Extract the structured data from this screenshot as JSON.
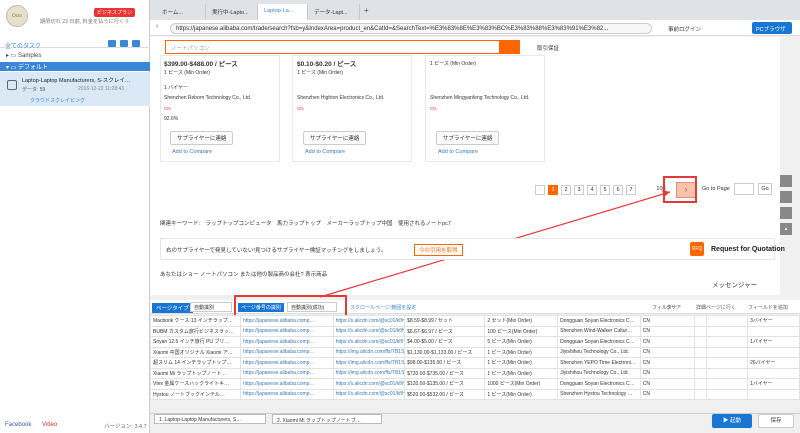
{
  "sidebar": {
    "premium": "ビジネスプラン",
    "trial": "期限切れ 22 日前, 料金を払うに行く 》",
    "tasks_title": "全てのタスク",
    "samples": "Samples",
    "default": "デフォルト",
    "task_title": "Laptop-Laptop Manufacturers, S-スクレイ…",
    "task_data": "データ: 59",
    "task_date": "2016-12-22 11:28:43",
    "task_cloud": "クラウドスクレイピング",
    "facebook": "Facebook",
    "video": "Video",
    "version": "バージョン: 3.4.7"
  },
  "tabs": [
    "ホーム...",
    "実行中-Lapto...",
    "Laptop-La...",
    "データ-Lapt..."
  ],
  "address": {
    "url": "https://japanese.alibaba.com/trade/search?fsb=y&IndexArea=product_en&CatId=&SearchText=%E3%83%8E%E3%83%BC%E3%83%88%E3%83%91%E3%82...",
    "login": "事前ログイン",
    "pc_label": "PCブラウザ"
  },
  "page": {
    "search_placeholder": "ノートパソコン",
    "verify": "取引保証",
    "cards": [
      {
        "price": "$399.00-$488.00 / ピース",
        "moq": "1 ピース (Min Order)",
        "buyer": "1 バイヤー",
        "company": "Shenzhen Reborn Technology Co., Ltd.",
        "country": "CN",
        "rate": "92.6%",
        "contact": "サプライヤーに連絡",
        "compare": "Add to Compare"
      },
      {
        "price": "$0.10-$0.20 / ピース",
        "moq": "1 ピース (Min Order)",
        "buyer": "",
        "company": "Shenzhen Highton Electronics Co., Ltd.",
        "country": "CN",
        "rate": "",
        "contact": "サプライヤーに連絡",
        "compare": "Add to Compare"
      },
      {
        "price": "",
        "moq": "1 ピース (Min Order)",
        "buyer": "",
        "company": "Shenzhen Mingyanfeng Technology Co., Ltd.",
        "country": "CN",
        "rate": "",
        "contact": "サプライヤーに連絡",
        "compare": "Add to Compare"
      }
    ],
    "pages": [
      "1",
      "2",
      "3",
      "4",
      "5",
      "6",
      "7",
      "100"
    ],
    "goto": "Go to Page",
    "go": "Go",
    "related": "関連キーワード:　ラップトップコンピュータ　馬力ラップトップ　メーカーラップトップ中国　使用されるノートpc7",
    "supplier_msg": "右のサプライヤーで発見していない!見つけるサプライヤー検証マッチングをしましょう。",
    "supplier_btn": "今の引用を取得",
    "rfq_icon": "RFQ",
    "rfq": "Request for Quotation",
    "supplier_q": "あなたはショー ノートパソコン または他の製品商の会社? 表示商品",
    "message": "メッセンジャー"
  },
  "data_toolbar": {
    "page_type": "ページタイプ",
    "auto_id": "自動識別",
    "page_num": "ページ番号の識別",
    "page_num_val": "自動識別(成功)",
    "scroll": "スクロールページ 範囲を設定",
    "filter": "フィルター",
    "clear": "クリア",
    "view": "詳細ページに行く",
    "add_field": "フィールドを追加"
  },
  "rows": [
    [
      "Macbook ケース 13 インチラップ…",
      "https://japanese.alibaba.comp…",
      "https://s.alicdn.com/@sc01/kf/H…",
      "$8.59-$8.99 / セット",
      "2 セット(Min Order)",
      "Dongguan Soyan Electronics C…",
      "CN",
      "",
      "",
      "3バイヤー"
    ],
    [
      "BUBM カスタム旅行ビジネスラッ…",
      "https://japanese.alibaba.comp…",
      "https://s.alicdn.com/@sc01/kf/H…",
      "$6.67-$6.97 / ピース",
      "100 ピース(Min Order)",
      "Shenzhen Wind-Walker Cultur…",
      "CN",
      "",
      "",
      ""
    ],
    [
      "Soyan 12.5 インチ旅行 PU ブリ…",
      "https://japanese.alibaba.comp…",
      "https://s.alicdn.com/@sc01/kf/H…",
      "$4.00-$5.00 / ピース",
      "5 ピース(Min Order)",
      "Dongguan Soyan Electronics C…",
      "CN",
      "",
      "",
      "1バイヤー"
    ],
    [
      "Xiaomi 中国オリジナル Xiaomi ア…",
      "https://japanese.alibaba.comp…",
      "https://img.alicdn.com/ffs/TB1S…",
      "$1,130.00-$1,133.00 / ピース",
      "1 ピース(Min Order)",
      "Jiyishihou Technology Co., Ltd.",
      "CN",
      "",
      "",
      ""
    ],
    [
      "超スリム 14 インチラップトップ…",
      "https://japanese.alibaba.comp…",
      "https://img.alicdn.com/ffs/TB1S…",
      "$98.00-$135.00 / ピース",
      "1 ピース(Min Order)",
      "Shenzhen YEPO Time Electroni…",
      "CN",
      "",
      "",
      "26バイヤー"
    ],
    [
      "Xiaomi Mi ラップトップノート…",
      "https://japanese.alibaba.comp…",
      "https://img.alicdn.com/ffs/TB1S…",
      "$720.00-$735.00 / ピース",
      "1 ピース(Min Order)",
      "Jiyishihou Technology Co., Ltd.",
      "CN",
      "",
      "",
      ""
    ],
    [
      "Vtex 金属ケースハックライトキ…",
      "https://japanese.alibaba.comp…",
      "https://s.alicdn.com/@sc01/kf/H…",
      "$120.00-$135.00 / ピース",
      "1000 ピース(Min Order)",
      "Dongguan Soyan Electronics C…",
      "CN",
      "",
      "",
      "1バイヤー"
    ],
    [
      "Hystou ノートブックインテル…",
      "https://japanese.alibaba.comp…",
      "https://s.alicdn.com/@sc01/kf/H…",
      "$520.00-$532.00 / ピース",
      "1 ピース(Min Order)",
      "Shenzhen Hystou Technology …",
      "CN",
      "",
      "",
      ""
    ]
  ],
  "bottom_tabs": [
    "1. Laptop-Laptop Manufacturers, S…",
    "2. Xiaomi Mi ラップトップノートブ…"
  ],
  "buttons": {
    "start": "▶ 起動",
    "save": "保存"
  }
}
